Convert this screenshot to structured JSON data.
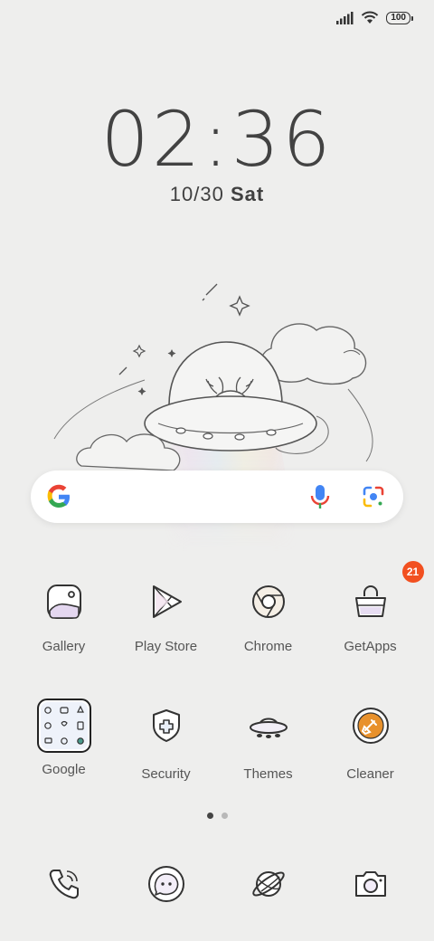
{
  "status_bar": {
    "battery": "100",
    "icons": [
      "signal-icon",
      "wifi-icon",
      "battery-icon"
    ]
  },
  "lockscreen": {
    "time": "02:36",
    "date": "10/30",
    "day": "Sat"
  },
  "search": {
    "icons": [
      "google-logo",
      "mic-icon",
      "lens-icon"
    ]
  },
  "apps": [
    {
      "label": "Gallery",
      "icon": "gallery-icon"
    },
    {
      "label": "Play Store",
      "icon": "play-store-icon"
    },
    {
      "label": "Chrome",
      "icon": "chrome-icon"
    },
    {
      "label": "GetApps",
      "icon": "getapps-icon",
      "badge": "21"
    },
    {
      "label": "Google",
      "icon": "google-folder-icon"
    },
    {
      "label": "Security",
      "icon": "security-icon"
    },
    {
      "label": "Themes",
      "icon": "themes-icon"
    },
    {
      "label": "Cleaner",
      "icon": "cleaner-icon"
    }
  ],
  "page_indicator": {
    "pages": 2,
    "active": 1
  },
  "dock": [
    "phone-icon",
    "messages-icon",
    "browser-icon",
    "camera-icon"
  ],
  "colors": {
    "background": "#eeeeed",
    "badge": "#f25020",
    "cleaner_accent": "#e8912c"
  }
}
